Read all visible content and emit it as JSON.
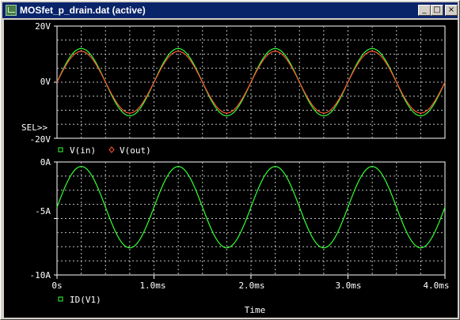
{
  "window": {
    "title": "MOSfet_p_drain.dat (active)",
    "buttons": {
      "minimize": "_",
      "maximize": "□",
      "close": "×"
    }
  },
  "colors": {
    "titlebar": "#0a246a",
    "plot_bg": "#000000",
    "grid": "#c0c0c0",
    "vin": "#33ff33",
    "vout": "#ff5533",
    "id": "#33ff33",
    "text": "#ffffff"
  },
  "chart_data": [
    {
      "type": "line",
      "y_ticks": [
        "20V",
        "0V",
        "-20V"
      ],
      "ylim": [
        -20,
        20
      ],
      "xlim": [
        0,
        4.0
      ],
      "sel_marker": "SEL>>",
      "legend": [
        {
          "name": "V(in)",
          "marker": "square",
          "color": "#33ff33"
        },
        {
          "name": "V(out)",
          "marker": "diamond",
          "color": "#ff5533"
        }
      ],
      "series": [
        {
          "name": "V(in)",
          "amplitude": 12,
          "offset": 0,
          "frequency_khz": 1,
          "color": "#33ff33"
        },
        {
          "name": "V(out)",
          "amplitude": 11,
          "offset": 0,
          "frequency_khz": 1,
          "color": "#ff5533"
        }
      ]
    },
    {
      "type": "line",
      "y_ticks": [
        "0A",
        "-5A",
        "-10A"
      ],
      "ylim": [
        -10,
        0
      ],
      "xlim": [
        0,
        4.0
      ],
      "x_ticks": [
        "0s",
        "1.0ms",
        "2.0ms",
        "3.0ms",
        "4.0ms"
      ],
      "xlabel": "Time",
      "legend": [
        {
          "name": "ID(V1)",
          "marker": "square",
          "color": "#33ff33"
        }
      ],
      "series": [
        {
          "name": "ID(V1)",
          "amplitude": 3.6,
          "offset": -4.0,
          "frequency_khz": 1,
          "color": "#33ff33"
        }
      ]
    }
  ]
}
